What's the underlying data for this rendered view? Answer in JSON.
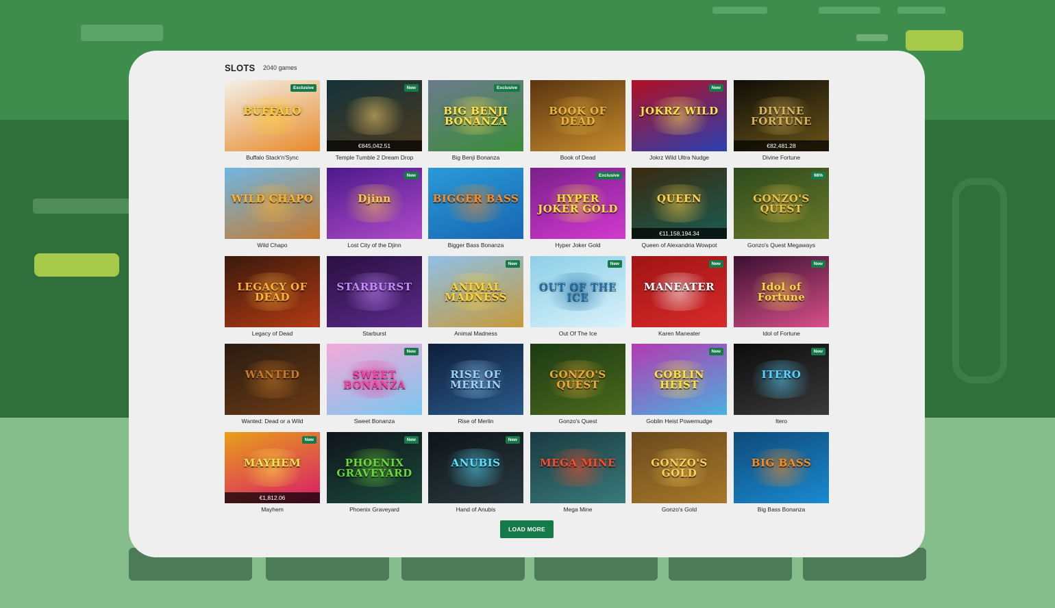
{
  "section": {
    "title": "SLOTS",
    "count": "2040 games"
  },
  "load_more_label": "LOAD MORE",
  "games": [
    {
      "name": "Buffalo Stack'n'Sync",
      "badge": "Exclusive",
      "logo": "BUFFALO",
      "c1": "#f3f0e8",
      "c2": "#e88a2a",
      "fg": "#ffcc33"
    },
    {
      "name": "Temple Tumble 2 Dream Drop",
      "badge": "New",
      "jackpot": "€845,042.51",
      "logo": "",
      "c1": "#14323a",
      "c2": "#4c3a1f",
      "fg": "#ffd36b"
    },
    {
      "name": "Big Benji Bonanza",
      "badge": "Exclusive",
      "logo": "BIG BENJI BONANZA",
      "c1": "#6b7a8c",
      "c2": "#3b8d3b",
      "fg": "#ffe24a"
    },
    {
      "name": "Book of Dead",
      "logo": "BOOK OF DEAD",
      "c1": "#5a3510",
      "c2": "#c58a2c",
      "fg": "#e9b23c"
    },
    {
      "name": "Jokrz Wild Ultra Nudge",
      "badge": "New",
      "logo": "JOKRZ WILD",
      "c1": "#b21024",
      "c2": "#2a3fb0",
      "fg": "#ffe14a"
    },
    {
      "name": "Divine Fortune",
      "jackpot": "€82,481.28",
      "logo": "DIVINE FORTUNE",
      "c1": "#0f0d08",
      "c2": "#6a5418",
      "fg": "#d9b45a"
    },
    {
      "name": "Wild Chapo",
      "logo": "WILD CHAPO",
      "c1": "#6fb6e3",
      "c2": "#c77a2c",
      "fg": "#ffb12a"
    },
    {
      "name": "Lost City of the Djinn",
      "badge": "New",
      "logo": "Djinn",
      "c1": "#4b1a8a",
      "c2": "#b04acb",
      "fg": "#ffc94a"
    },
    {
      "name": "Bigger Bass Bonanza",
      "logo": "BIGGER BASS",
      "c1": "#2a9ad8",
      "c2": "#1767b2",
      "fg": "#ff8a1f"
    },
    {
      "name": "Hyper Joker Gold",
      "badge": "Exclusive",
      "logo": "HYPER JOKER GOLD",
      "c1": "#7a1f8a",
      "c2": "#d23ad0",
      "fg": "#ffdd3a"
    },
    {
      "name": "Queen of Alexandria Wowpot",
      "jackpot": "€11,158,194.34",
      "logo": "QUEEN",
      "c1": "#3a2a10",
      "c2": "#1a5c52",
      "fg": "#ffd24a"
    },
    {
      "name": "Gonzo's Quest Megaways",
      "badge": "98%",
      "logo": "GONZO'S QUEST",
      "c1": "#2e4a1c",
      "c2": "#6b7a2a",
      "fg": "#e9c24a"
    },
    {
      "name": "Legacy of Dead",
      "logo": "LEGACY OF DEAD",
      "c1": "#3a1a0c",
      "c2": "#b23a14",
      "fg": "#ffb13a"
    },
    {
      "name": "Starburst",
      "logo": "STARBURST",
      "c1": "#2a1040",
      "c2": "#5a2a8a",
      "fg": "#c58aff"
    },
    {
      "name": "Animal Madness",
      "badge": "New",
      "logo": "ANIMAL MADNESS",
      "c1": "#8ec0e8",
      "c2": "#c79a3a",
      "fg": "#ffd13a"
    },
    {
      "name": "Out Of The Ice",
      "badge": "New",
      "logo": "OUT OF THE ICE",
      "c1": "#8ccfe8",
      "c2": "#d9f2fa",
      "fg": "#1f6fa8"
    },
    {
      "name": "Karen Maneater",
      "badge": "New",
      "logo": "MANEATER",
      "c1": "#a01414",
      "c2": "#d82a2a",
      "fg": "#ffffff"
    },
    {
      "name": "Idol of Fortune",
      "badge": "New",
      "logo": "Idol of Fortune",
      "c1": "#3a1030",
      "c2": "#d8508a",
      "fg": "#ffd24a"
    },
    {
      "name": "Wanted: Dead or a Wild",
      "logo": "WANTED",
      "c1": "#2a1c10",
      "c2": "#6a3a16",
      "fg": "#c87a2a"
    },
    {
      "name": "Sweet Bonanza",
      "badge": "New",
      "logo": "SWEET BONANZA",
      "c1": "#f4a8d8",
      "c2": "#7ac8f0",
      "fg": "#ff3aa0"
    },
    {
      "name": "Rise of Merlin",
      "logo": "RISE OF MERLIN",
      "c1": "#0e1e3a",
      "c2": "#2a5a8a",
      "fg": "#9ad2ff"
    },
    {
      "name": "Gonzo's Quest",
      "logo": "GONZO'S QUEST",
      "c1": "#1c3a14",
      "c2": "#4a6a1c",
      "fg": "#e9a83a"
    },
    {
      "name": "Goblin Heist Powernudge",
      "badge": "New",
      "logo": "GOBLIN HEIST",
      "c1": "#b33ab0",
      "c2": "#4ab0e0",
      "fg": "#ffe13a"
    },
    {
      "name": "Itero",
      "badge": "New",
      "logo": "ITERO",
      "c1": "#0c0c0c",
      "c2": "#3a3a3a",
      "fg": "#5ad2ff"
    },
    {
      "name": "Mayhem",
      "badge": "New",
      "jackpot": "€1,812.06",
      "logo": "MAYHEM",
      "c1": "#e8a01a",
      "c2": "#d81a6a",
      "fg": "#ffe14a"
    },
    {
      "name": "Phoenix Graveyard",
      "badge": "New",
      "logo": "PHOENIX GRAVEYARD",
      "c1": "#10141c",
      "c2": "#1a4a3a",
      "fg": "#6ad83a"
    },
    {
      "name": "Hand of Anubis",
      "badge": "New",
      "logo": "ANUBIS",
      "c1": "#0e1418",
      "c2": "#2a3a40",
      "fg": "#5ae0ff"
    },
    {
      "name": "Mega Mine",
      "logo": "MEGA MINE",
      "c1": "#1a3a40",
      "c2": "#3a7a7a",
      "fg": "#ff4a2a"
    },
    {
      "name": "Gonzo's Gold",
      "logo": "GONZO'S GOLD",
      "c1": "#6a4a1c",
      "c2": "#a8782a",
      "fg": "#ffcf5a"
    },
    {
      "name": "Big Bass Bonanza",
      "logo": "BIG BASS",
      "c1": "#0e4a7a",
      "c2": "#1a8ad0",
      "fg": "#ff8a1a"
    }
  ]
}
